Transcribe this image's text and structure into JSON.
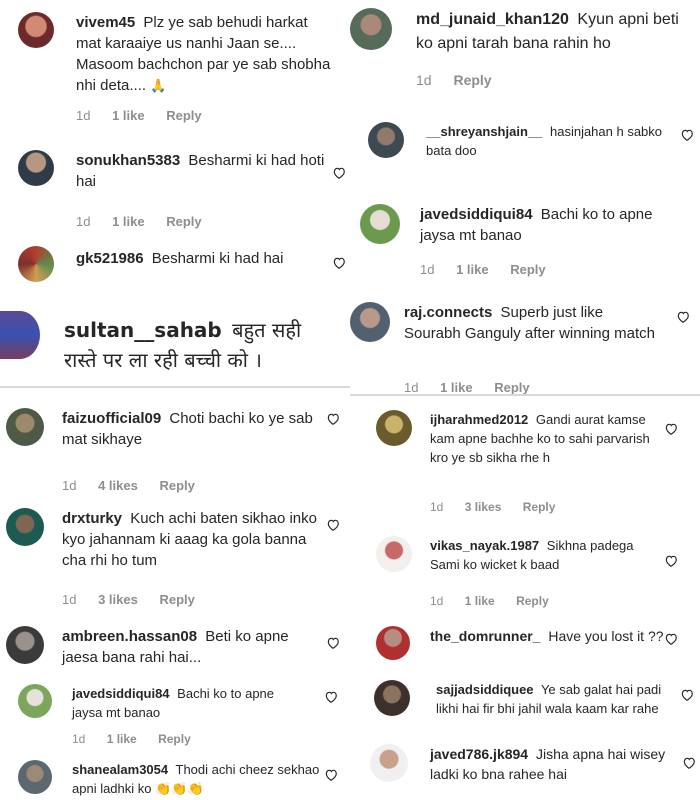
{
  "comments": [
    {
      "user": "vivem45",
      "text": "Plz ye sab behudi harkat mat karaaiye us nanhi Jaan se.... Masoom bachchon par ye sab shobha nhi deta....",
      "emoji": "🙏",
      "time": "1d",
      "likes": "1 like",
      "reply": "Reply"
    },
    {
      "user": "sonukhan5383",
      "text": "Besharmi ki had hoti hai",
      "time": "1d",
      "likes": "1 like",
      "reply": "Reply"
    },
    {
      "user": "gk521986",
      "text": "Besharmi ki had hai",
      "time": "",
      "likes": "",
      "reply": ""
    },
    {
      "user": "sultan__sahab",
      "text": "बहुत सही रास्ते पर ला रही बच्ची को ।",
      "time": "",
      "likes": "",
      "reply": ""
    },
    {
      "user": "faizuofficial09",
      "text": "Choti bachi ko ye sab mat sikhaye",
      "time": "1d",
      "likes": "4 likes",
      "reply": "Reply"
    },
    {
      "user": "drxturky",
      "text": "Kuch achi baten sikhao inko kyo jahannam ki aaag ka gola banna cha rhi ho tum",
      "time": "1d",
      "likes": "3 likes",
      "reply": "Reply"
    },
    {
      "user": "ambreen.hassan08",
      "text": "Beti ko apne jaesa bana rahi hai...",
      "time": "",
      "likes": "",
      "reply": ""
    },
    {
      "user": "javedsiddiqui84",
      "text": "Bachi ko to apne jaysa mt banao",
      "time": "1d",
      "likes": "1 like",
      "reply": "Reply"
    },
    {
      "user": "shanealam3054",
      "text": "Thodi achi cheez sekhao apni ladhki ko",
      "emoji": "👏👏👏",
      "time": "",
      "likes": "",
      "reply": ""
    },
    {
      "user": "md_junaid_khan120",
      "text": "Kyun apni beti ko apni tarah bana rahin ho",
      "time": "1d",
      "likes": "",
      "reply": "Reply"
    },
    {
      "user": "__shreyanshjain__",
      "text": "hasinjahan h sabko bata doo",
      "time": "",
      "likes": "",
      "reply": ""
    },
    {
      "user": "javedsiddiqui84",
      "text": "Bachi ko to apne jaysa mt banao",
      "time": "1d",
      "likes": "1 like",
      "reply": "Reply"
    },
    {
      "user": "raj.connects",
      "text": "Superb just like Sourabh Ganguly after winning match",
      "time": "1d",
      "likes": "1 like",
      "reply": "Reply"
    },
    {
      "user": "ijharahmed2012",
      "text": "Gandi aurat kamse kam apne bachhe ko to sahi parvarish kro ye sb sikha rhe h",
      "time": "1d",
      "likes": "3 likes",
      "reply": "Reply"
    },
    {
      "user": "vikas_nayak.1987",
      "text": "Sikhna padega Sami ko wicket k baad",
      "time": "1d",
      "likes": "1 like",
      "reply": "Reply"
    },
    {
      "user": "the_domrunner_",
      "text": "Have you lost it ??",
      "time": "",
      "likes": "",
      "reply": ""
    },
    {
      "user": "sajjadsiddiquee",
      "text": "Ye sab galat hai padi likhi hai fir bhi jahil wala kaam kar rahe",
      "time": "",
      "likes": "",
      "reply": ""
    },
    {
      "user": "javed786.jk894",
      "text": "Jisha apna hai wisey ladki ko bna rahee hai",
      "time": "",
      "likes": "",
      "reply": ""
    }
  ],
  "colors": {
    "text": "#262626",
    "meta": "#8e8e8e",
    "divider": "#d9d9d9"
  }
}
